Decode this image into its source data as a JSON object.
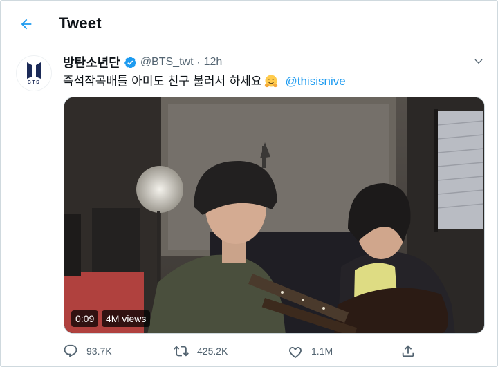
{
  "header": {
    "title": "Tweet",
    "back_icon": "arrow-left-icon"
  },
  "tweet": {
    "avatar": {
      "brand_text": "BTS",
      "brand_color": "#1b2a57"
    },
    "author": {
      "display_name": "방탄소년단",
      "handle": "@BTS_twt",
      "verified": true
    },
    "separator": "·",
    "time": "12h",
    "text": "즉석작곡배틀 아미도 친구 불러서 하세요",
    "emoji": "hugging-face-emoji",
    "mention": "@thisisnive",
    "media": {
      "type": "video",
      "duration": "0:09",
      "views": "4M views"
    },
    "actions": {
      "reply_count": "93.7K",
      "retweet_count": "425.2K",
      "like_count": "1.1M",
      "share_icon": "share-icon"
    }
  },
  "colors": {
    "accent": "#1d9bf0",
    "text_primary": "#0f1419",
    "text_secondary": "#536471",
    "divider": "#e6ecf0"
  }
}
